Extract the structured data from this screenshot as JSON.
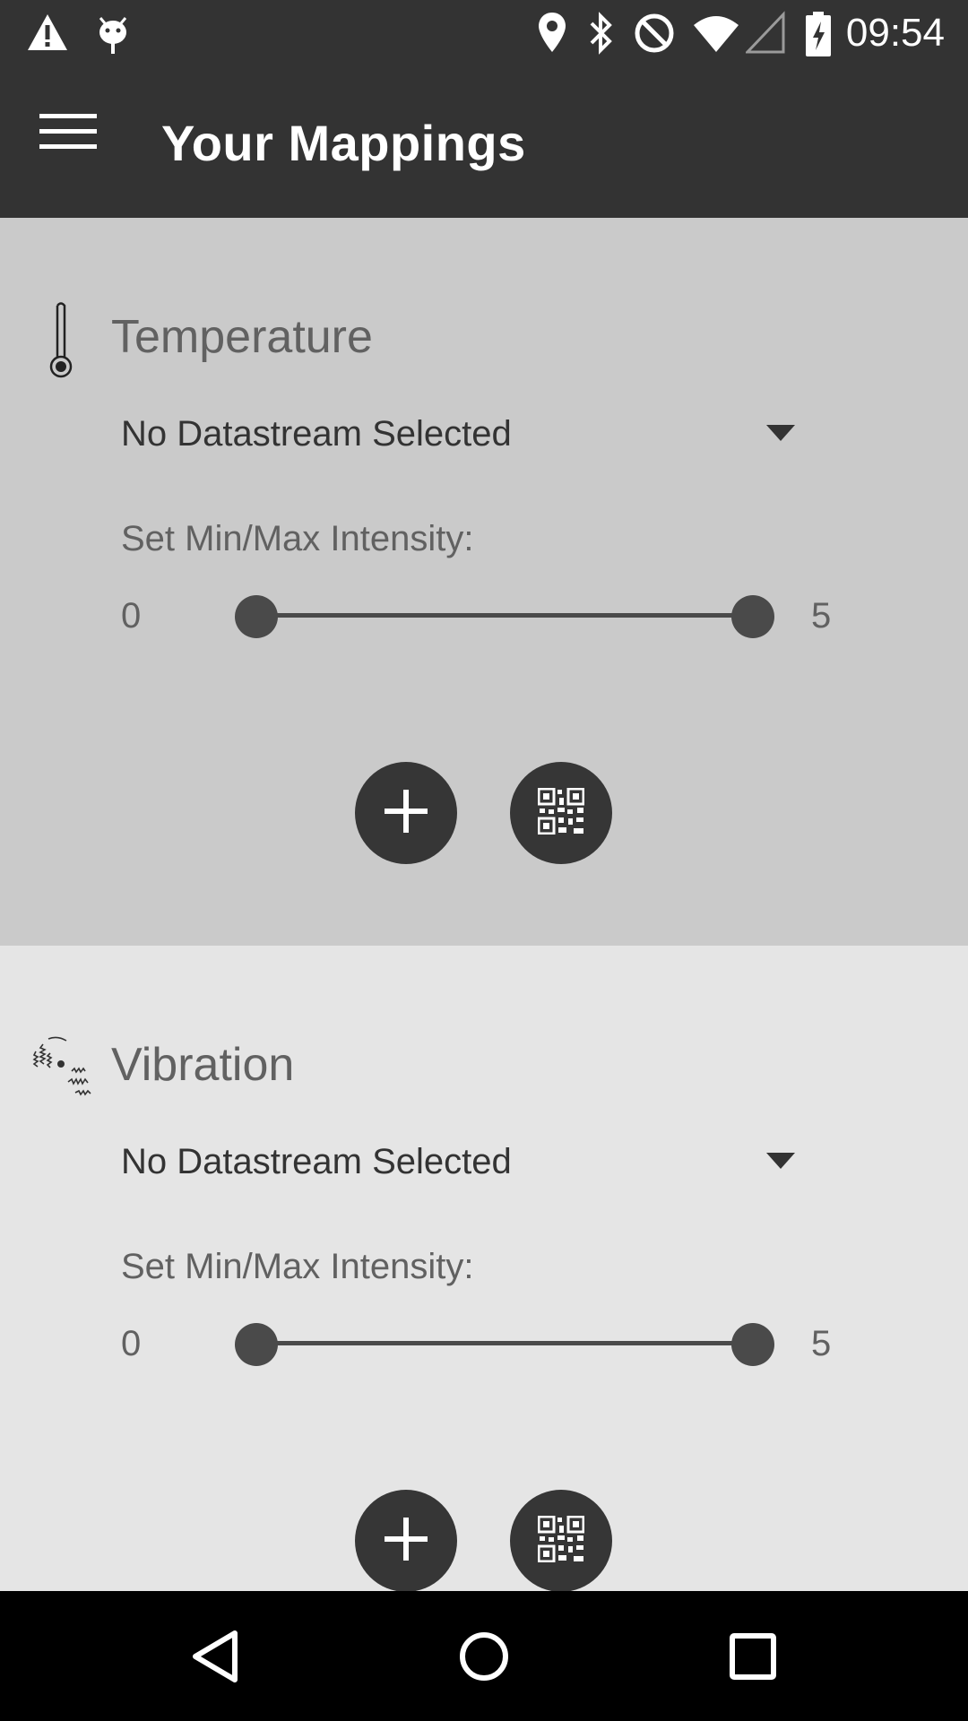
{
  "status_bar": {
    "time": "09:54",
    "icons": [
      "warning-icon",
      "android-debug-icon",
      "location-icon",
      "bluetooth-icon",
      "do-not-disturb-icon",
      "wifi-icon",
      "signal-icon",
      "battery-charging-icon"
    ]
  },
  "app_bar": {
    "title": "Your Mappings",
    "menu_icon": "hamburger-menu-icon"
  },
  "mappings": [
    {
      "sensor": "Temperature",
      "icon": "thermometer-icon",
      "datastream": "No Datastream Selected",
      "intensity_label": "Set Min/Max Intensity:",
      "min_value": "0",
      "max_value": "5",
      "slider_min": 0,
      "slider_max": 5,
      "buttons": [
        "add-icon",
        "qr-code-icon"
      ]
    },
    {
      "sensor": "Vibration",
      "icon": "vibration-icon",
      "datastream": "No Datastream Selected",
      "intensity_label": "Set Min/Max Intensity:",
      "min_value": "0",
      "max_value": "5",
      "slider_min": 0,
      "slider_max": 5,
      "buttons": [
        "add-icon",
        "qr-code-icon"
      ]
    }
  ],
  "nav_bar": {
    "icons": [
      "back-icon",
      "home-icon",
      "recents-icon"
    ]
  },
  "colors": {
    "app_bar": "#333333",
    "card_active": "#cacaca",
    "card_inactive": "#e5e5e5",
    "fab": "#363636",
    "nav_bar": "#000000"
  }
}
